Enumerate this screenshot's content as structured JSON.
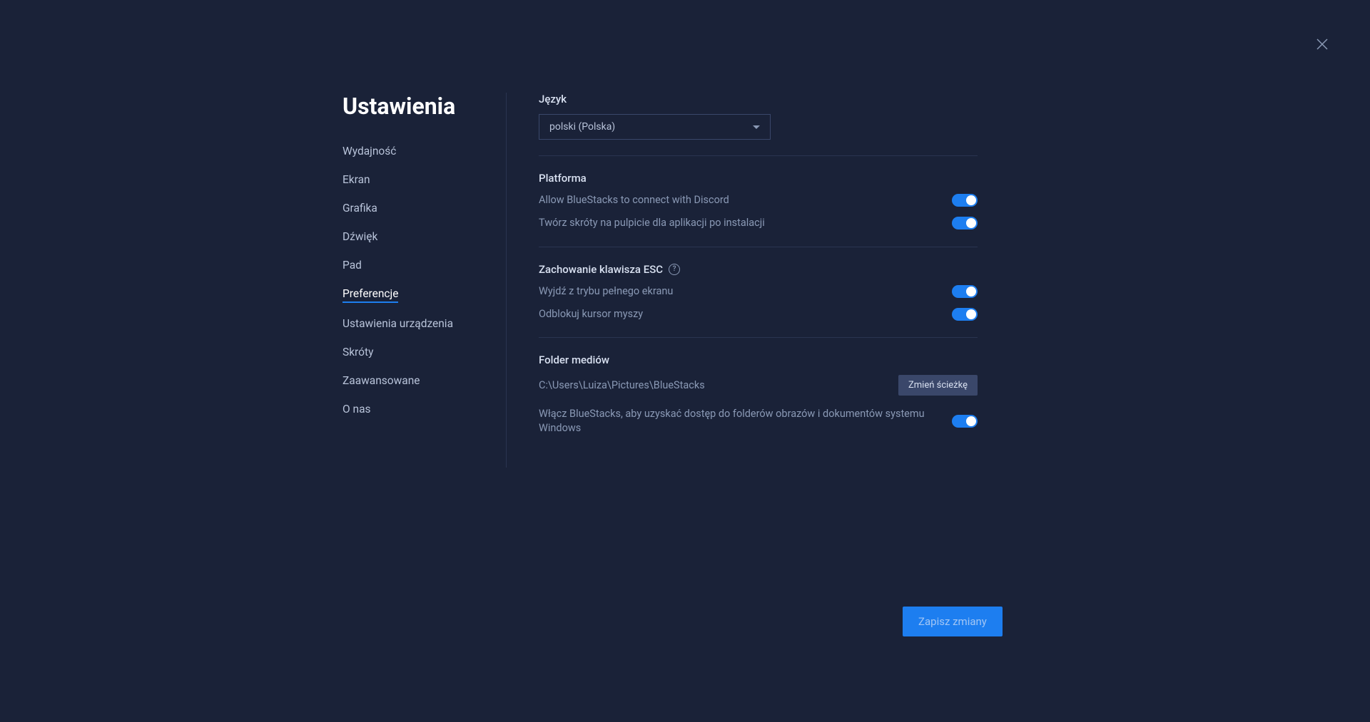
{
  "title": "Ustawienia",
  "sidebar": {
    "items": [
      {
        "label": "Wydajność",
        "active": false
      },
      {
        "label": "Ekran",
        "active": false
      },
      {
        "label": "Grafika",
        "active": false
      },
      {
        "label": "Dźwięk",
        "active": false
      },
      {
        "label": "Pad",
        "active": false
      },
      {
        "label": "Preferencje",
        "active": true
      },
      {
        "label": "Ustawienia urządzenia",
        "active": false
      },
      {
        "label": "Skróty",
        "active": false
      },
      {
        "label": "Zaawansowane",
        "active": false
      },
      {
        "label": "O nas",
        "active": false
      }
    ]
  },
  "sections": {
    "language": {
      "title": "Język",
      "selected": "polski (Polska)"
    },
    "platform": {
      "title": "Platforma",
      "discord_label": "Allow BlueStacks to connect with Discord",
      "shortcuts_label": "Twórz skróty na pulpicie dla aplikacji po instalacji"
    },
    "esc": {
      "title": "Zachowanie klawisza ESC",
      "fullscreen_label": "Wyjdź z trybu pełnego ekranu",
      "cursor_label": "Odblokuj kursor myszy"
    },
    "media": {
      "title": "Folder mediów",
      "path": "C:\\Users\\Luiza\\Pictures\\BlueStacks",
      "change_button": "Zmień ścieżkę",
      "access_label": "Włącz BlueStacks, aby uzyskać dostęp do folderów obrazów i dokumentów systemu Windows"
    }
  },
  "save_button": "Zapisz zmiany"
}
